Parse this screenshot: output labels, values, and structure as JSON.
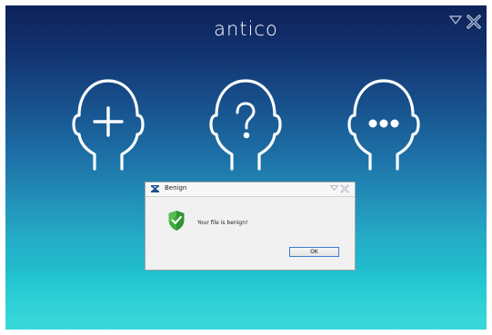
{
  "app": {
    "logo": "antico"
  },
  "window_controls": {
    "minimize_icon": "triangle-down-icon",
    "close_icon": "close-x-icon"
  },
  "actions": [
    {
      "name": "add",
      "icon": "plus-icon"
    },
    {
      "name": "help",
      "icon": "question-icon"
    },
    {
      "name": "more",
      "icon": "ellipsis-icon"
    }
  ],
  "dialog": {
    "title": "Benign",
    "message": "Your file is benign!",
    "ok_label": "OK",
    "status_icon": "shield-check-icon",
    "colors": {
      "shield_green": "#3fae3b",
      "ok_border": "#3c7fd0"
    }
  }
}
